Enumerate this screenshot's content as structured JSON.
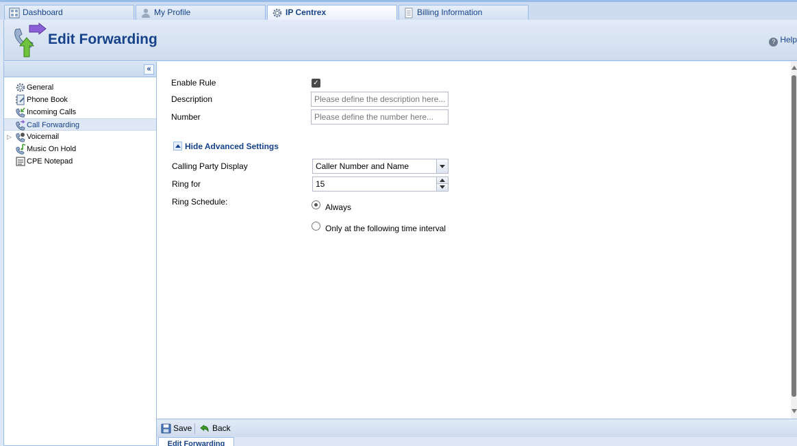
{
  "tabs": [
    {
      "label": "Dashboard",
      "icon": "dashboard-icon"
    },
    {
      "label": "My Profile",
      "icon": "user-icon"
    },
    {
      "label": "IP Centrex",
      "icon": "gear-icon",
      "active": true
    },
    {
      "label": "Billing Information",
      "icon": "document-icon"
    }
  ],
  "header": {
    "title": "Edit Forwarding",
    "help": "Help"
  },
  "sidebar": {
    "items": [
      {
        "label": "General",
        "icon": "gear-icon"
      },
      {
        "label": "Phone Book",
        "icon": "phonebook-icon"
      },
      {
        "label": "Incoming Calls",
        "icon": "incoming-call-icon"
      },
      {
        "label": "Call Forwarding",
        "icon": "call-forward-icon",
        "active": true
      },
      {
        "label": "Voicemail",
        "icon": "voicemail-icon",
        "expandable": true
      },
      {
        "label": "Music On Hold",
        "icon": "music-icon"
      },
      {
        "label": "CPE Notepad",
        "icon": "notepad-icon"
      }
    ]
  },
  "form": {
    "enable_rule_label": "Enable Rule",
    "enable_rule_checked": true,
    "description_label": "Description",
    "description_placeholder": "Please define the description here...",
    "number_label": "Number",
    "number_placeholder": "Please define the number here...",
    "advanced_toggle": "Hide Advanced Settings",
    "calling_party_label": "Calling Party Display",
    "calling_party_value": "Caller Number and Name",
    "ring_for_label": "Ring for",
    "ring_for_value": "15",
    "ring_schedule_label": "Ring Schedule:",
    "schedule_always": "Always",
    "schedule_interval": "Only at the following time interval",
    "schedule_selected": "Always"
  },
  "toolbar": {
    "save_label": "Save",
    "back_label": "Back"
  },
  "bottom_tab": "Edit Forwarding",
  "colors": {
    "accent": "#15428b",
    "border": "#99bbe8",
    "header_bg": "#dfe8f6"
  }
}
